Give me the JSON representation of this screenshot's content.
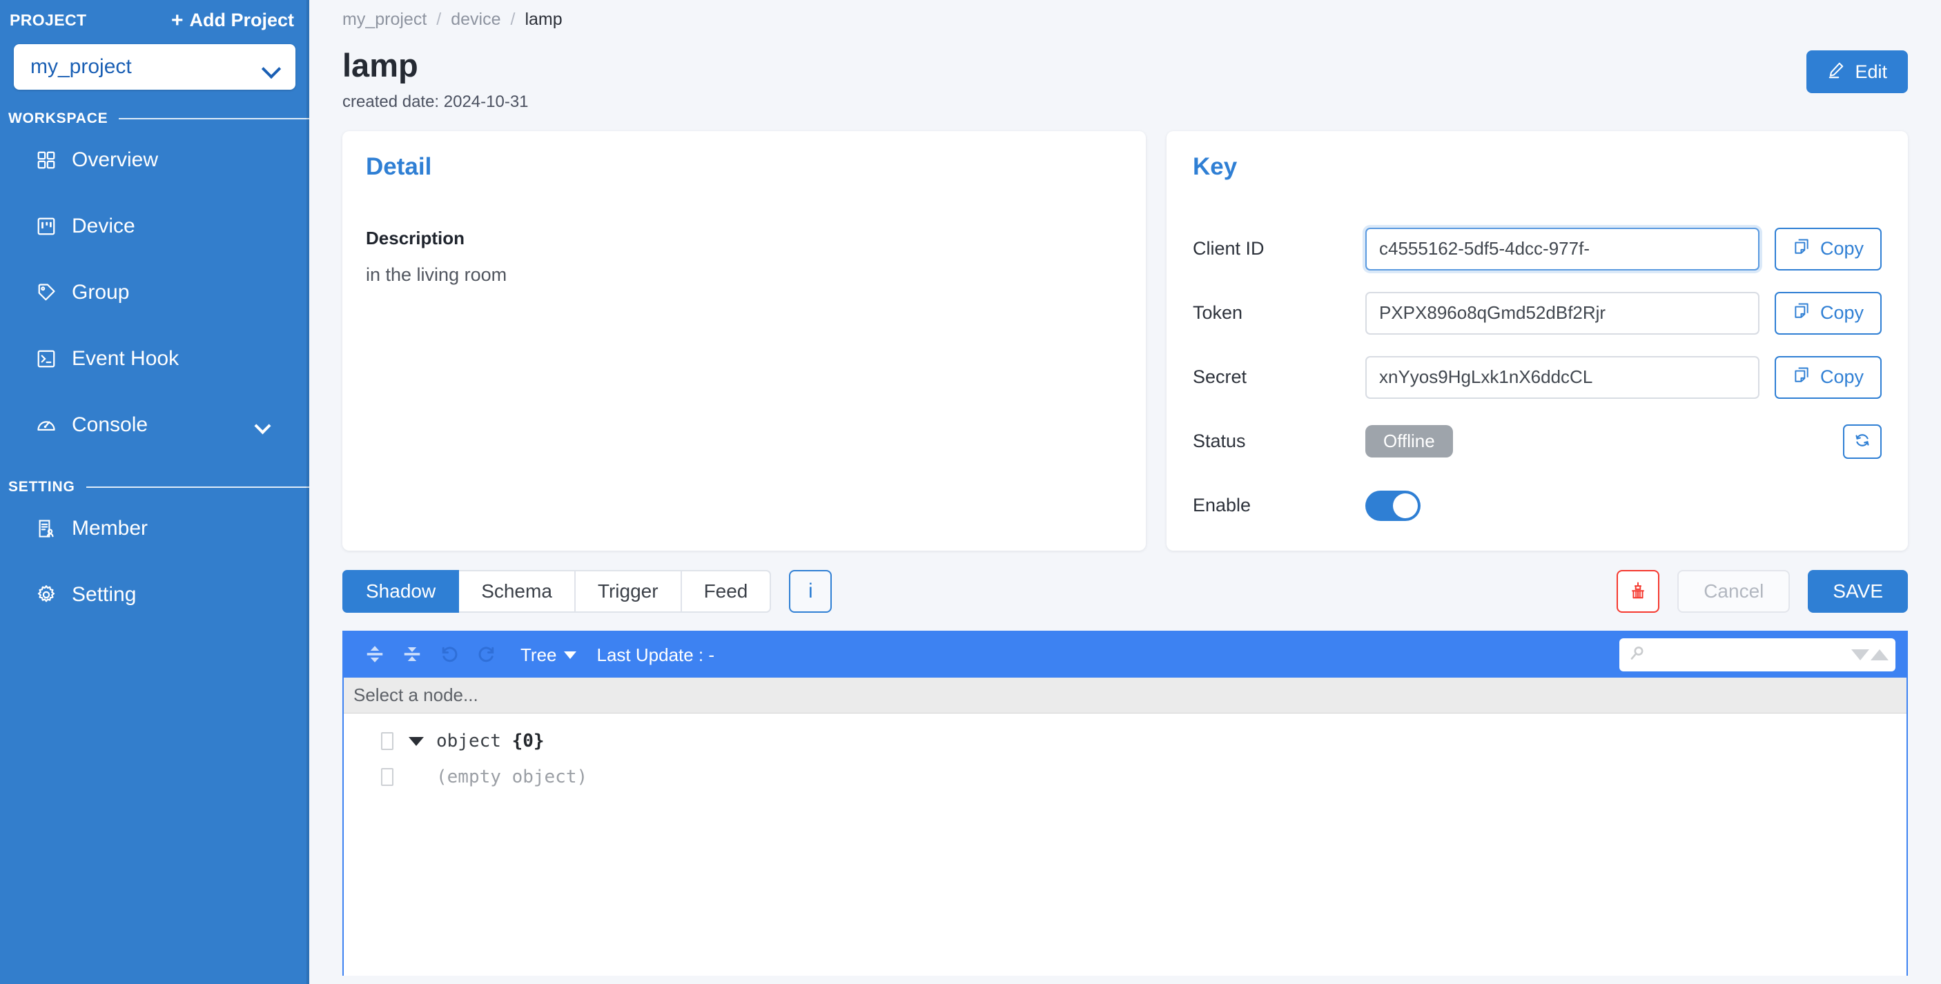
{
  "sidebar": {
    "project_label": "PROJECT",
    "add_project_label": "Add Project",
    "add_project_plus": "+",
    "project_selected": "my_project",
    "sections": [
      {
        "title": "WORKSPACE"
      },
      {
        "title": "SETTING"
      }
    ],
    "workspace_items": [
      {
        "label": "Overview",
        "icon": "grid-icon"
      },
      {
        "label": "Device",
        "icon": "device-icon"
      },
      {
        "label": "Group",
        "icon": "tag-icon"
      },
      {
        "label": "Event Hook",
        "icon": "terminal-icon"
      },
      {
        "label": "Console",
        "icon": "gauge-icon",
        "caret": true
      }
    ],
    "setting_items": [
      {
        "label": "Member",
        "icon": "member-icon"
      },
      {
        "label": "Setting",
        "icon": "gear-icon"
      }
    ]
  },
  "breadcrumb": {
    "items": [
      "my_project",
      "device",
      "lamp"
    ],
    "separator": "/"
  },
  "header": {
    "title": "lamp",
    "created": "created date: 2024-10-31",
    "edit_label": "Edit"
  },
  "detail": {
    "card_title": "Detail",
    "description_label": "Description",
    "description_value": "in the living room"
  },
  "key": {
    "card_title": "Key",
    "rows": [
      {
        "label": "Client ID",
        "value": "c4555162-5df5-4dcc-977f-",
        "copy_label": "Copy",
        "focused": true
      },
      {
        "label": "Token",
        "value": "PXPX896o8qGmd52dBf2Rjr",
        "copy_label": "Copy",
        "focused": false
      },
      {
        "label": "Secret",
        "value": "xnYyos9HgLxk1nX6ddcCL",
        "copy_label": "Copy",
        "focused": false
      }
    ],
    "status_label": "Status",
    "status_value": "Offline",
    "enable_label": "Enable",
    "enable_on": true
  },
  "tabs": {
    "items": [
      {
        "label": "Shadow",
        "active": true
      },
      {
        "label": "Schema",
        "active": false
      },
      {
        "label": "Trigger",
        "active": false
      },
      {
        "label": "Feed",
        "active": false
      }
    ],
    "info_label": "i"
  },
  "actions": {
    "cancel_label": "Cancel",
    "save_label": "SAVE"
  },
  "json_editor": {
    "mode_label": "Tree",
    "last_update": "Last Update : -",
    "search_placeholder": "",
    "search_value": "",
    "path_placeholder": "Select a node...",
    "tree": {
      "root_label": "object",
      "root_count": "{0}",
      "child_label": "(empty object)"
    }
  },
  "colors": {
    "brand_blue": "#2f7fd4",
    "sidebar_blue": "#337ecc",
    "editor_blue": "#3d82f2",
    "danger_red": "#f5382e",
    "status_grey": "#9ea4ab"
  }
}
